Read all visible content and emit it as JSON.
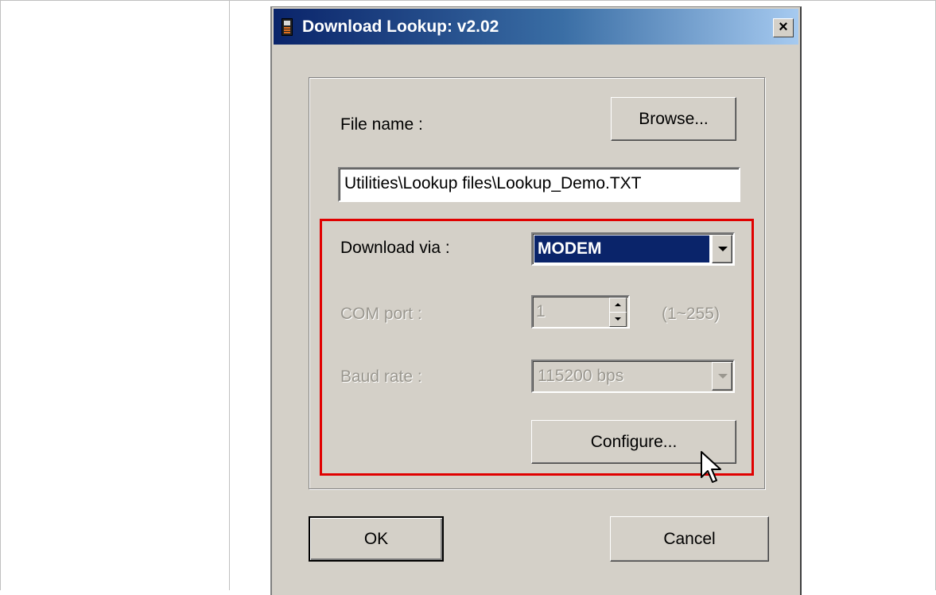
{
  "window": {
    "title": "Download Lookup: v2.02",
    "close_glyph": "×"
  },
  "file": {
    "label": "File name :",
    "browse_label": "Browse...",
    "path_value": "Utilities\\Lookup files\\Lookup_Demo.TXT"
  },
  "download": {
    "label": "Download via :",
    "selected_value": "MODEM"
  },
  "com_port": {
    "label": "COM port :",
    "value": "1",
    "range_hint": "(1~255)"
  },
  "baud_rate": {
    "label": "Baud rate :",
    "value": "115200 bps"
  },
  "configure_label": "Configure...",
  "footer": {
    "ok_label": "OK",
    "cancel_label": "Cancel"
  },
  "colors": {
    "highlight_box": "#e00000",
    "title_bar_start": "#0a246a",
    "selection": "#0a246a"
  }
}
